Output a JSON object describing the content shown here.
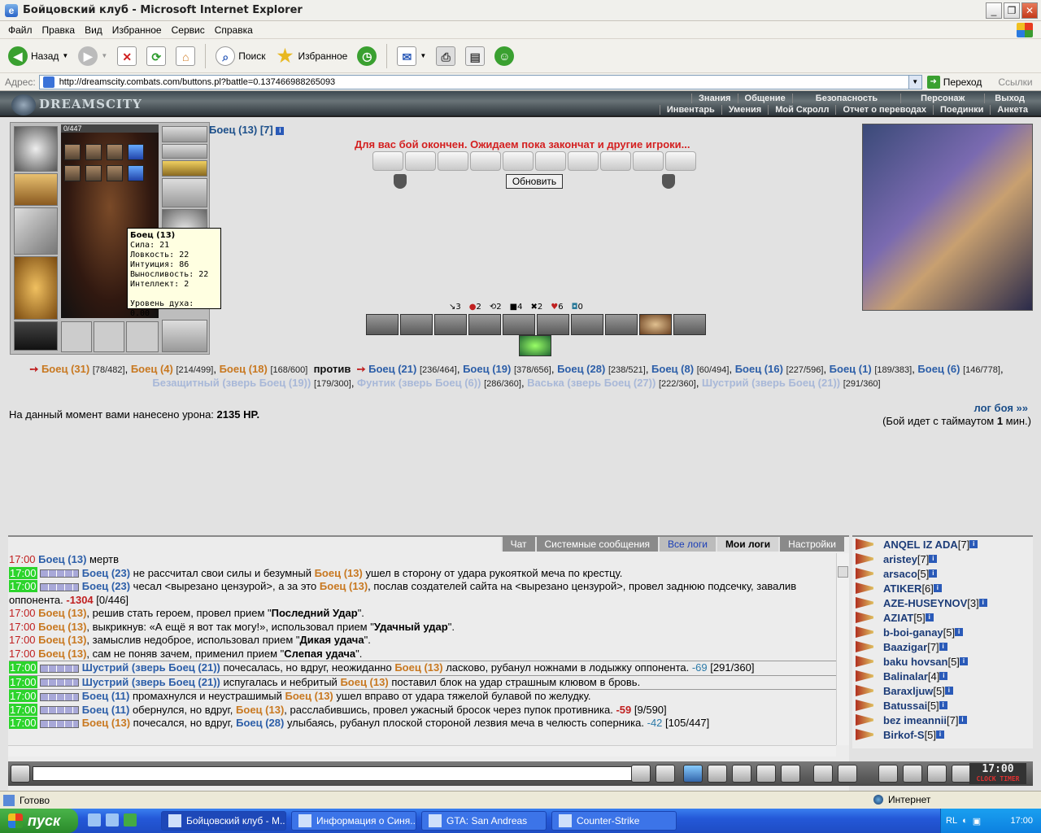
{
  "window": {
    "title": "Бойцовский клуб - Microsoft Internet Explorer"
  },
  "menu": [
    "Файл",
    "Правка",
    "Вид",
    "Избранное",
    "Сервис",
    "Справка"
  ],
  "toolbar": {
    "back": "Назад",
    "search": "Поиск",
    "favorites": "Избранное"
  },
  "address": {
    "label": "Адрес:",
    "url": "http://dreamscity.combats.com/buttons.pl?battle=0.137466988265093",
    "go": "Переход",
    "links": "Ссылки"
  },
  "game": {
    "logo": "DREAMSCITY",
    "nav_top": [
      "Знания",
      "Общение",
      "Безопасность",
      "Персонаж",
      "Выход"
    ],
    "nav_bottom": [
      "Инвентарь",
      "Умения",
      "Мой Скролл",
      "Отчет о переводах",
      "Поединки",
      "Анкета"
    ],
    "hp": "0/447",
    "fighter": "Боец (13) [7]",
    "notice": "Для вас бой окончен. Ожидаем пока закончат и другие игроки...",
    "refresh": "Обновить",
    "tooltip": {
      "name": "Боец (13)",
      "lines": [
        "Сила: 21",
        "Ловкость: 22",
        "Интуиция: 86",
        "Выносливость: 22",
        "Интеллект: 2"
      ],
      "spirit": "Уровень духа: 0.00"
    },
    "stats": [
      "3",
      "2",
      "2",
      "4",
      "2",
      "6",
      "0"
    ],
    "teams": {
      "own": [
        {
          "n": "Боец (31)",
          "hp": "[78/482]"
        },
        {
          "n": "Боец (4)",
          "hp": "[214/499]"
        },
        {
          "n": "Боец (18)",
          "hp": "[168/600]"
        }
      ],
      "vs": "против",
      "enemy": [
        {
          "n": "Боец (21)",
          "hp": "[236/464]"
        },
        {
          "n": "Боец (19)",
          "hp": "[378/656]"
        },
        {
          "n": "Боец (28)",
          "hp": "[238/521]"
        },
        {
          "n": "Боец (8)",
          "hp": "[60/494]"
        },
        {
          "n": "Боец (16)",
          "hp": "[227/596]"
        },
        {
          "n": "Боец (1)",
          "hp": "[189/383]"
        },
        {
          "n": "Боец (6)",
          "hp": "[146/778]"
        }
      ],
      "beasts": [
        {
          "n": "Безащитный (зверь Боец (19))",
          "hp": "[179/300]"
        },
        {
          "n": "Фунтик (зверь Боец (6))",
          "hp": "[286/360]"
        },
        {
          "n": "Васька (зверь Боец (27))",
          "hp": "[222/360]"
        },
        {
          "n": "Шустрий (зверь Боец (21))",
          "hp": "[291/360]"
        }
      ]
    },
    "damage_label": "На данный момент вами нанесено урона:",
    "damage_value": "2135 HP.",
    "log_link": "лог боя »»",
    "timeout_pre": "(Бой идет с таймаутом",
    "timeout_value": "1",
    "timeout_post": "мин.)"
  },
  "tabs": [
    "Чат",
    "Системные сообщения",
    "Все логи",
    "Мои логи",
    "Настройки"
  ],
  "log": {
    "l1": {
      "time": "17:00",
      "who": "Боец (13)",
      "text": "мертв"
    },
    "l2": {
      "time": "17:00",
      "who": "Боец (23)",
      "mid": "не рассчитал свои силы и безумный",
      "who2": "Боец (13)",
      "end": "ушел в сторону от удара рукояткой меча по крестцу."
    },
    "l3": {
      "time": "17:00",
      "who": "Боец (23)",
      "mid": "чесал <вырезано цензурой>, а за это",
      "who2": "Боец (13)",
      "end": ", послав создателей сайта на <вырезано цензурой>, провел заднюю подсечку, завалив оппонента.",
      "dmg": "-1304",
      "hp": "[0/446]"
    },
    "l4": {
      "time": "17:00",
      "who": "Боец (13)",
      "mid": ", решив стать героем, провел прием \"",
      "skill": "Последний Удар",
      "end": "\"."
    },
    "l5": {
      "time": "17:00",
      "who": "Боец (13)",
      "mid": ", выкрикнув: «А ещё я вот так могу!», использовал прием \"",
      "skill": "Удачный удар",
      "end": "\"."
    },
    "l6": {
      "time": "17:00",
      "who": "Боец (13)",
      "mid": ", замыслив недоброе, использовал прием \"",
      "skill": "Дикая удача",
      "end": "\"."
    },
    "l7": {
      "time": "17:00",
      "who": "Боец (13)",
      "mid": ", сам не поняв зачем, применил прием \"",
      "skill": "Слепая удача",
      "end": "\"."
    },
    "l8": {
      "time": "17:00",
      "who": "Шустрий (зверь Боец (21))",
      "mid": "почесалась, но вдруг, неожиданно",
      "who2": "Боец (13)",
      "end": "ласково, рубанул ножнами в лодыжку оппонента.",
      "dmg": "-69",
      "hp": "[291/360]"
    },
    "l9": {
      "time": "17:00",
      "who": "Шустрий (зверь Боец (21))",
      "mid": "испугалась и небритый",
      "who2": "Боец (13)",
      "end": "поставил блок на удар страшным клювом в бровь."
    },
    "l10": {
      "time": "17:00",
      "who": "Боец (11)",
      "mid": "промахнулся и неустрашимый",
      "who2": "Боец (13)",
      "end": "ушел вправо от удара тяжелой булавой по желудку."
    },
    "l11": {
      "time": "17:00",
      "who": "Боец (11)",
      "mid": "обернулся, но вдруг,",
      "who2": "Боец (13)",
      "end": ", расслабившись, провел ужасный бросок через пупок противника.",
      "dmg": "-59",
      "hp": "[9/590]"
    },
    "l12": {
      "time": "17:00",
      "who": "Боец (13)",
      "mid": "почесался, но вдруг,",
      "who2": "Боец (28)",
      "end": "улыбаясь, рубанул плоской стороной лезвия меча в челюсть соперника.",
      "dmg": "-42",
      "hp": "[105/447]"
    }
  },
  "users": [
    {
      "n": "ANQEL IZ ADA",
      "l": "[7]"
    },
    {
      "n": "aristey",
      "l": "[7]"
    },
    {
      "n": "arsaco",
      "l": "[5]"
    },
    {
      "n": "ATIKER",
      "l": "[6]"
    },
    {
      "n": "AZE-HUSEYNOV",
      "l": "[3]"
    },
    {
      "n": "AZIAT",
      "l": "[5]"
    },
    {
      "n": "b-boi-ganay",
      "l": "[5]"
    },
    {
      "n": "Baazigar",
      "l": "[7]"
    },
    {
      "n": "baku hovsan",
      "l": "[5]"
    },
    {
      "n": "Balinalar",
      "l": "[4]"
    },
    {
      "n": "Baraxljuw",
      "l": "[5]"
    },
    {
      "n": "Batussai",
      "l": "[5]"
    },
    {
      "n": "bez imeannii",
      "l": "[7]"
    },
    {
      "n": "Birkof-S",
      "l": "[5]"
    }
  ],
  "clock": {
    "time": "17:00",
    "label": "CLOCK TIMER"
  },
  "status": {
    "ready": "Готово",
    "zone": "Интернет"
  },
  "taskbar": {
    "start": "пуск",
    "tasks": [
      "Бойцовский клуб - M...",
      "Информация о Синя...",
      "GTA: San Andreas",
      "Counter-Strike"
    ],
    "lang": "RL",
    "time": "17:00"
  }
}
